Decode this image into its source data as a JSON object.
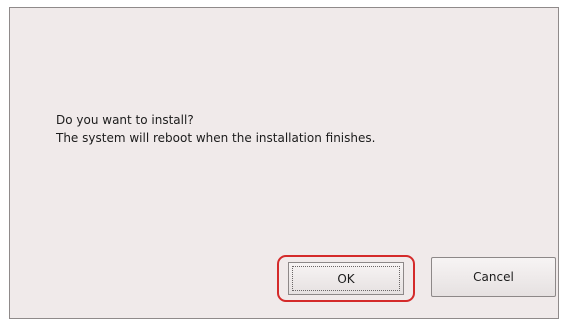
{
  "dialog": {
    "message_line1": "Do you want to install?",
    "message_line2": "The system will reboot when the installation finishes.",
    "ok_label": "OK",
    "cancel_label": "Cancel",
    "highlight_color": "#d42a2a"
  }
}
